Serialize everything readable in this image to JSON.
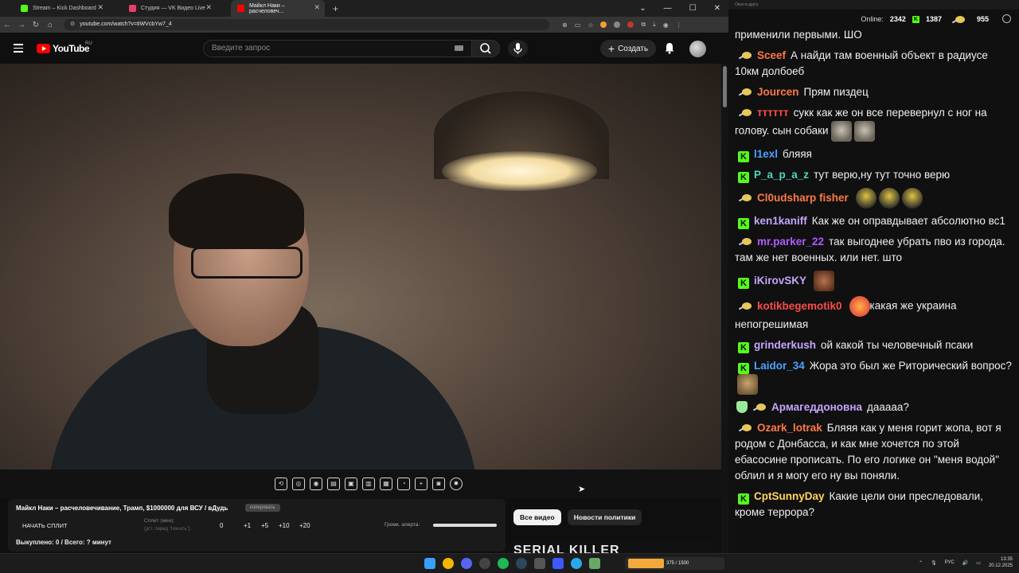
{
  "browser": {
    "tabs": [
      {
        "title": "Stream – Kick Dashboard",
        "color": "#53fc18"
      },
      {
        "title": "Студия — VK Видео Live",
        "color": "#e83e6b"
      },
      {
        "title": "Майкл Наки – расчеловеч...",
        "color": "#ff0000"
      }
    ],
    "url": "youtube.com/watch?v=tiWVcbYw7_4"
  },
  "youtube": {
    "logo": "YouTube",
    "region": "RU",
    "search_placeholder": "Введите запрос",
    "create_label": "Создать"
  },
  "panel": {
    "video_title": "Майкл Наки – расчеловечивание, Трамп, $1000000 для ВСУ / вДудь",
    "copy_label": "копировать",
    "start_split": "НАЧАТЬ СПЛИТ",
    "split_min": "Сплит (мин):",
    "split_hint": "(уст. перед \"Начать\")",
    "split_value": "0",
    "steps": [
      "+1",
      "+5",
      "+10",
      "+20"
    ],
    "alert_label": "Громк. алерта:",
    "alert_volume": 1.0,
    "bought": "Выкуплено: 0 / Всего: ? минут"
  },
  "chips": [
    "Все видео",
    "Новости политики"
  ],
  "thumb_text": "SERIAL KILLER",
  "chat": {
    "window_title": "Окно в другу",
    "online_label": "Online:",
    "online": "2342",
    "kick_count": "1387",
    "sub_count": "955",
    "messages": [
      {
        "badge": "",
        "user": "",
        "color": "#ffffff",
        "text": "применили первыми. ШО",
        "emotes": []
      },
      {
        "badge": "sub",
        "user": "Sceef",
        "color": "#ff7a45",
        "text": "А найди там военный объект в радиусе 10км долбоеб",
        "emotes": []
      },
      {
        "badge": "sub",
        "user": "Jourcen",
        "color": "#ff7a45",
        "text": "Прям пиздец",
        "emotes": []
      },
      {
        "badge": "sub",
        "user": "тттттт",
        "color": "#ff4b4b",
        "text": "сукк как же он все перевернул с ног на голову. сын собаки",
        "emotes": [
          "dog",
          "dog"
        ]
      },
      {
        "badge": "kick",
        "user": "l1exl",
        "color": "#4aa3ff",
        "text": "бляяя",
        "emotes": []
      },
      {
        "badge": "kick",
        "user": "P_a_p_a_z",
        "color": "#4dd9c0",
        "text": "тут верю,ну тут точно верю",
        "emotes": []
      },
      {
        "badge": "sub",
        "user": "Cl0udsharp fisher",
        "color": "#ff7a45",
        "text": "",
        "emotes": [
          "pepe",
          "pepe",
          "pepe"
        ]
      },
      {
        "badge": "kick",
        "user": "ken1kaniff",
        "color": "#c6a5ff",
        "text": "Как же он оправдывает абсолютно вс1",
        "emotes": []
      },
      {
        "badge": "sub",
        "user": "mr.parker_22",
        "color": "#b05cff",
        "text": "так выгоднее убрать пво из города. там же нет военных. или нет. што",
        "emotes": []
      },
      {
        "badge": "kick",
        "user": "iKirovSKY",
        "color": "#c6a5ff",
        "text": "",
        "emotes": [
          "face"
        ]
      },
      {
        "badge": "sub",
        "user": "kotikbegemotik0",
        "color": "#ff4b4b",
        "text": "какая же украина непогрешимая",
        "emotes": [
          "fire"
        ]
      },
      {
        "badge": "kick",
        "user": "grinderkush",
        "color": "#c6a5ff",
        "text": "ой какой ты человечный псаки",
        "emotes": []
      },
      {
        "badge": "kick",
        "user": "Laidor_34",
        "color": "#4aa3ff",
        "text": "Жора это был же Риторический вопрос?",
        "emotes": [
          "cat"
        ]
      },
      {
        "badge": "shield-sub",
        "user": "Армагеддоновна",
        "color": "#c6a5ff",
        "text": "дааааа?",
        "emotes": []
      },
      {
        "badge": "sub",
        "user": "Ozark_lotrak",
        "color": "#ff7a45",
        "text": "Бляяя как у меня горит жопа, вот я родом с Донбасса, и как мне хочется по этой ебасосине прописать. По его логике он \"меня водой\" облил и я могу его ну вы поняли.",
        "emotes": []
      },
      {
        "badge": "kick",
        "user": "CptSunnyDay",
        "color": "#ffd65a",
        "text": "Какие цели они преследовали, кроме террора?",
        "emotes": []
      }
    ]
  },
  "taskbar": {
    "stream_counter": "375 / 1500",
    "lang": "РУС",
    "time": "13:35",
    "date": "20.12.2025"
  }
}
